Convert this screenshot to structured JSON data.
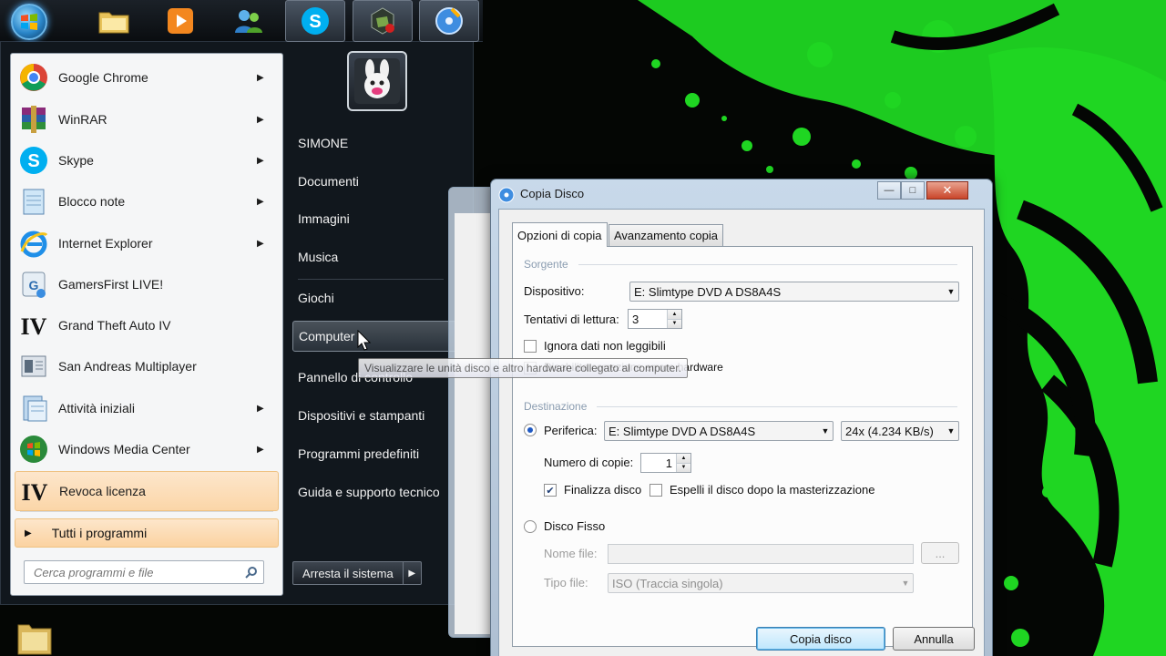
{
  "taskbar": {
    "buttons": [
      {
        "name": "windows-explorer",
        "icon": "folder-icon"
      },
      {
        "name": "media-player",
        "icon": "play-icon"
      },
      {
        "name": "messenger",
        "icon": "people-icon"
      },
      {
        "name": "skype",
        "icon": "skype-icon"
      },
      {
        "name": "app-green",
        "icon": "app-icon"
      },
      {
        "name": "disc-burner",
        "icon": "disc-icon"
      }
    ]
  },
  "start_menu": {
    "programs": [
      {
        "label": "Google Chrome",
        "icon": "chrome-icon",
        "submenu": true
      },
      {
        "label": "WinRAR",
        "icon": "winrar-icon",
        "submenu": true
      },
      {
        "label": "Skype",
        "icon": "skype-icon",
        "submenu": true
      },
      {
        "label": "Blocco note",
        "icon": "notepad-icon",
        "submenu": true
      },
      {
        "label": "Internet Explorer",
        "icon": "ie-icon",
        "submenu": true
      },
      {
        "label": "GamersFirst LIVE!",
        "icon": "gamersfirst-icon",
        "submenu": false
      },
      {
        "label": "Grand Theft Auto IV",
        "icon": "gta-iv-icon",
        "submenu": false
      },
      {
        "label": "San Andreas Multiplayer",
        "icon": "samp-icon",
        "submenu": false
      },
      {
        "label": "Attività iniziali",
        "icon": "getting-started-icon",
        "submenu": true
      },
      {
        "label": "Windows Media Center",
        "icon": "media-center-icon",
        "submenu": true
      },
      {
        "label": "Revoca licenza",
        "icon": "gta-iv-icon",
        "submenu": false,
        "highlighted": true
      }
    ],
    "all_programs": "Tutti i programmi",
    "search_placeholder": "Cerca programmi e file",
    "places": [
      "SIMONE",
      "Documenti",
      "Immagini",
      "Musica",
      "Giochi",
      "Computer",
      "Pannello di controllo",
      "Dispositivi e stampanti",
      "Programmi predefiniti",
      "Guida e supporto tecnico"
    ],
    "shutdown_label": "Arresta il sistema",
    "tooltip": "Visualizzare le unità disco e altro hardware collegato al computer."
  },
  "dialog": {
    "title": "Copia Disco",
    "tabs": [
      "Opzioni di copia",
      "Avanzamento copia"
    ],
    "source_group": "Sorgente",
    "device_label": "Dispositivo:",
    "device_value": "E: Slimtype DVD A  DS8A4S",
    "retries_label": "Tentativi di lettura:",
    "retries_value": "3",
    "ignore_unreadable": "Ignora dati non leggibili",
    "disable_error_correction": "Disabilita correzione errore hardware",
    "dest_group": "Destinazione",
    "burner_label": "Periferica:",
    "burner_value": "E: Slimtype DVD A  DS8A4S",
    "speed_value": "24x (4.234 KB/s)",
    "copies_label": "Numero di copie:",
    "copies_value": "1",
    "finalize_label": "Finalizza disco",
    "finalize_checked": true,
    "eject_label": "Espelli il disco dopo la masterizzazione",
    "eject_checked": false,
    "hard_disk_label": "Disco Fisso",
    "filename_label": "Nome file:",
    "browse_label": "...",
    "filetype_label": "Tipo file:",
    "filetype_value": "ISO (Traccia singola)",
    "ok_label": "Copia disco",
    "cancel_label": "Annulla"
  },
  "colors": {
    "wallpaper_green": "#1fd622",
    "menu_highlight": "#fbd6a8"
  }
}
